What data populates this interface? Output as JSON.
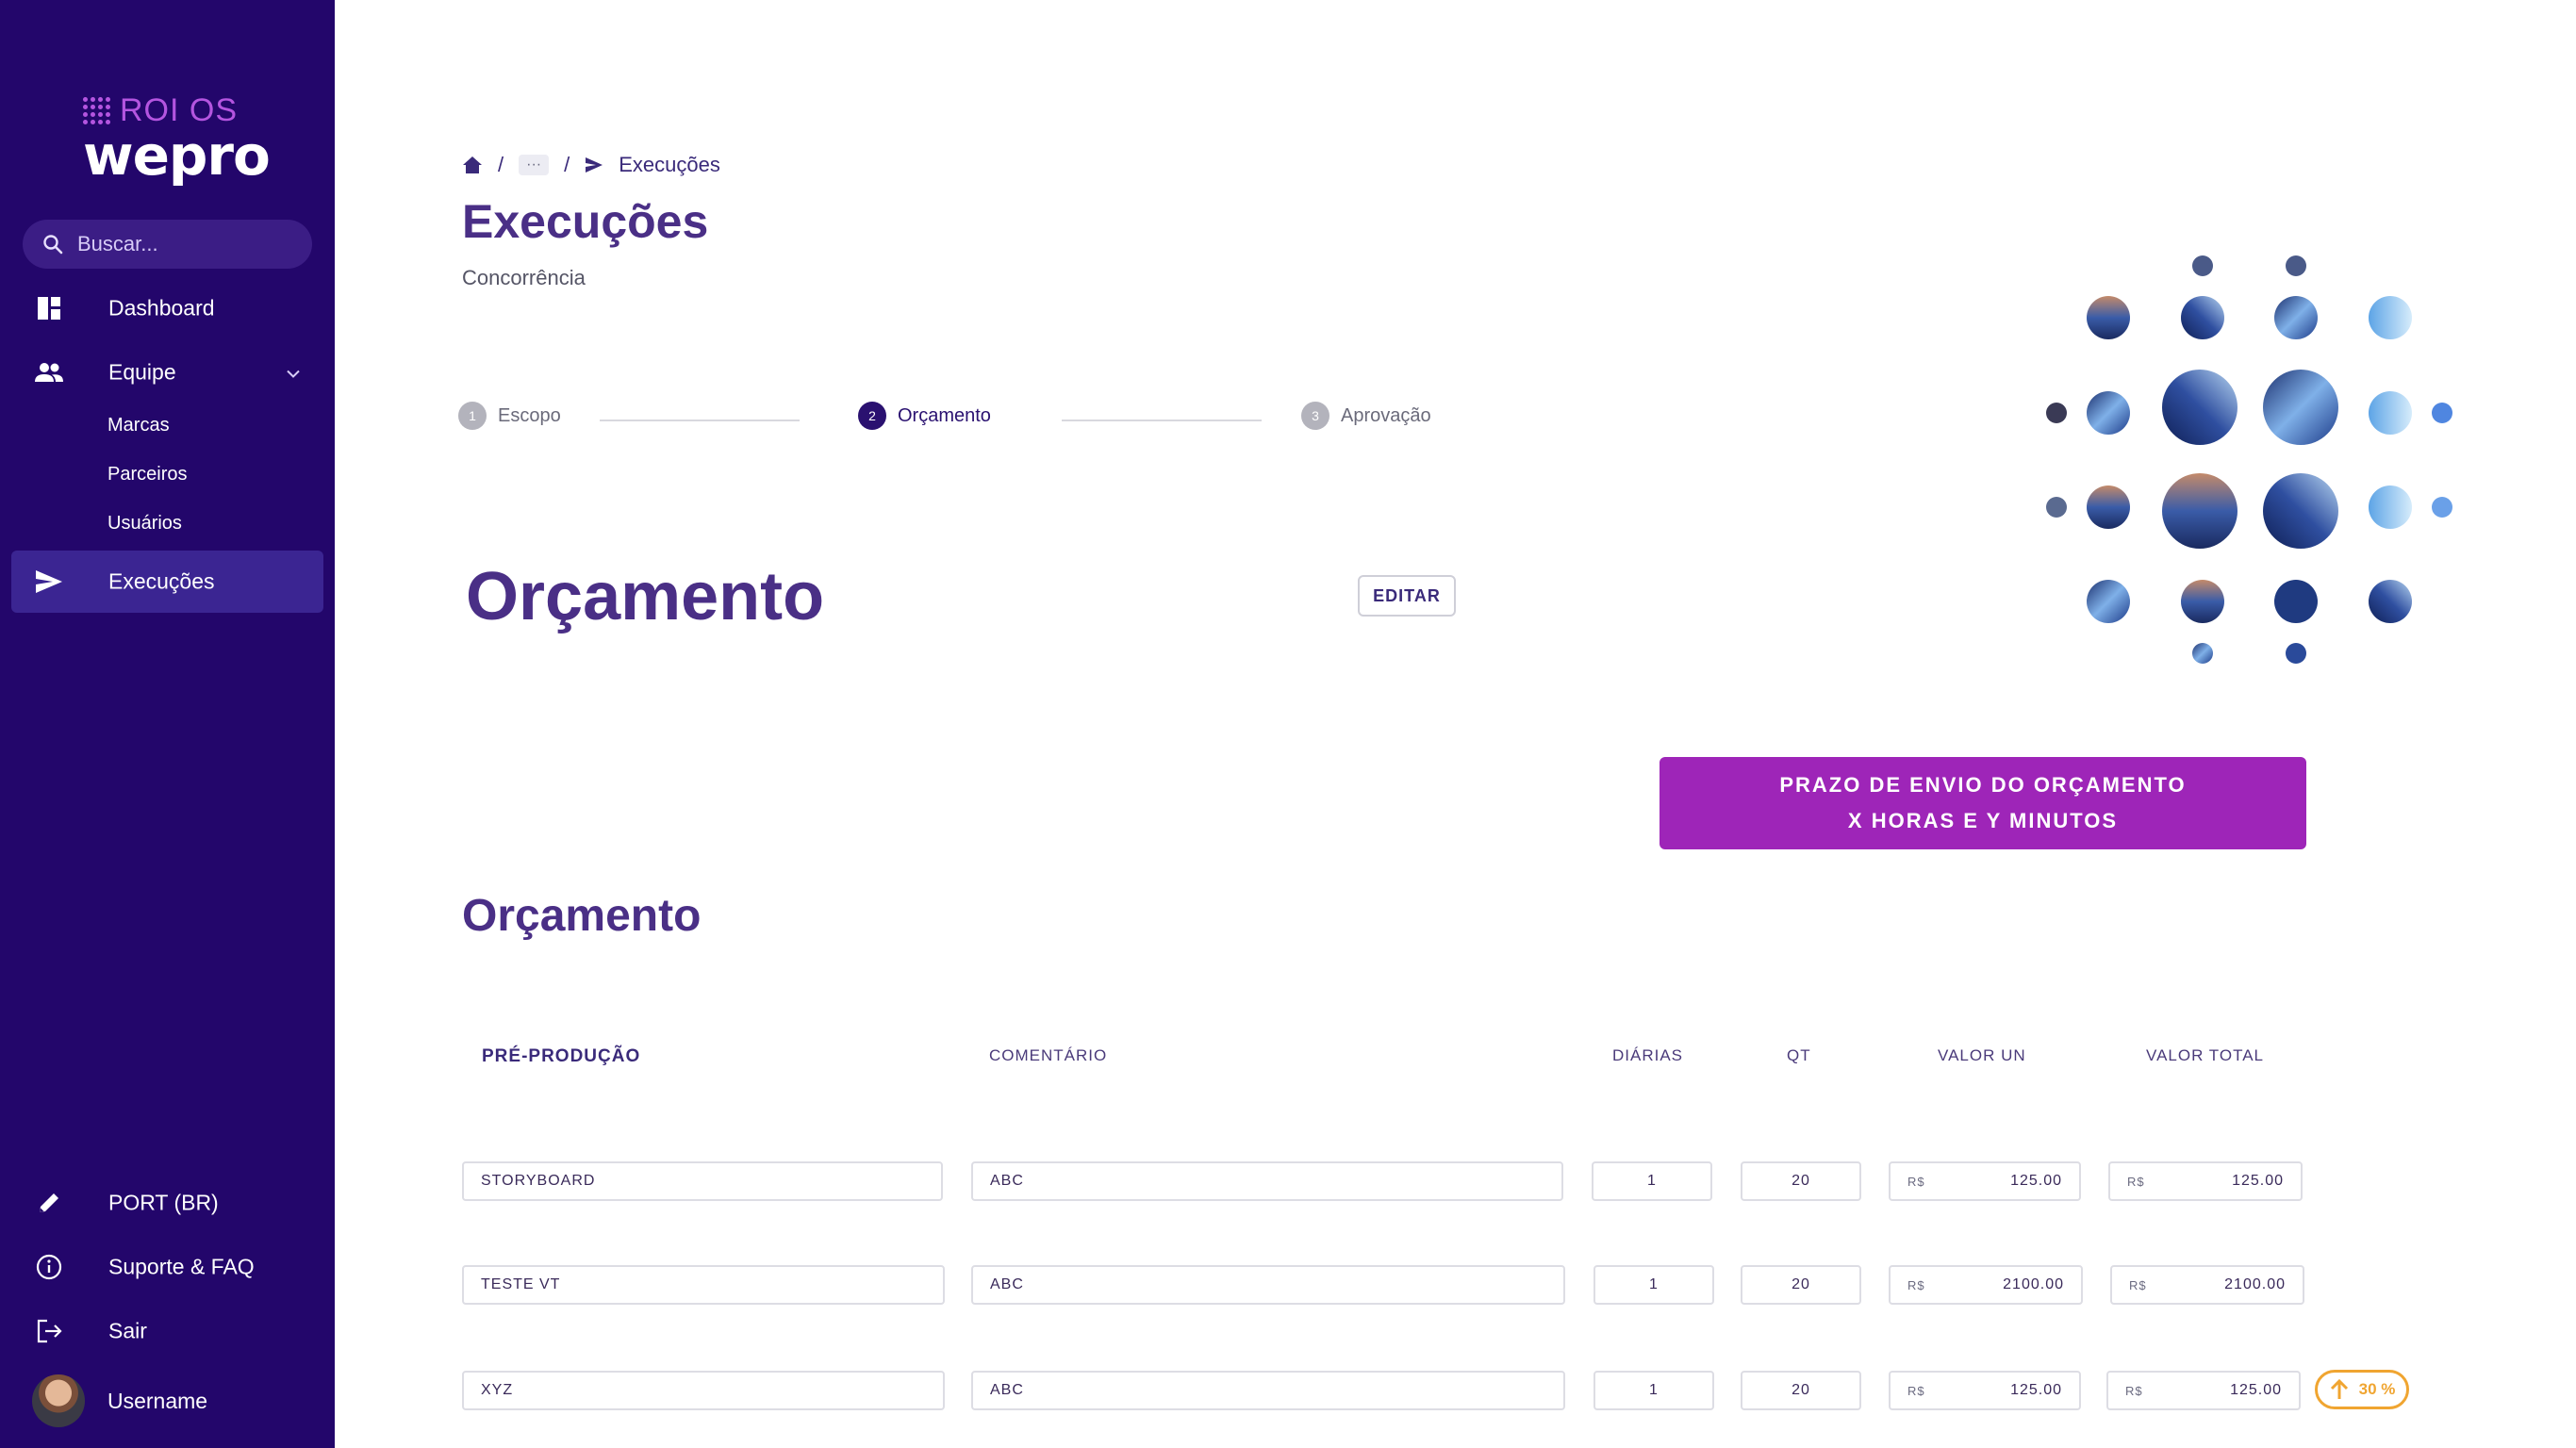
{
  "brand": {
    "small": "ROI OS",
    "big": "wepro"
  },
  "search": {
    "placeholder": "Buscar..."
  },
  "nav": {
    "dashboard": "Dashboard",
    "equipe": "Equipe",
    "sub": [
      "Marcas",
      "Parceiros",
      "Usuários"
    ],
    "execucoes": "Execuções"
  },
  "bottom_nav": {
    "language": "PORT (BR)",
    "support": "Suporte & FAQ",
    "logout": "Sair",
    "username": "Username"
  },
  "breadcrumb": {
    "current": "Execuções",
    "ellipsis": "···"
  },
  "page": {
    "title": "Execuções",
    "subtitle": "Concorrência"
  },
  "stepper": [
    {
      "num": "1",
      "label": "Escopo"
    },
    {
      "num": "2",
      "label": "Orçamento"
    },
    {
      "num": "3",
      "label": "Aprovação"
    }
  ],
  "section": {
    "title": "Orçamento",
    "edit": "EDITAR"
  },
  "deadline": {
    "line1": "PRAZO DE ENVIO DO ORÇAMENTO",
    "line2": "X HORAS E Y MINUTOS"
  },
  "budget": {
    "title": "Orçamento",
    "headers": {
      "item": "PRÉ-PRODUÇÃO",
      "comment": "COMENTÁRIO",
      "days": "DIÁRIAS",
      "qty": "QT",
      "unit": "VALOR UN",
      "total": "VALOR TOTAL"
    },
    "currency": "R$",
    "rows": [
      {
        "item": "STORYBOARD",
        "comment": "ABC",
        "days": "1",
        "qty": "20",
        "unit": "125.00",
        "total": "125.00"
      },
      {
        "item": "TESTE VT",
        "comment": "ABC",
        "days": "1",
        "qty": "20",
        "unit": "2100.00",
        "total": "2100.00"
      },
      {
        "item": "XYZ",
        "comment": "ABC",
        "days": "1",
        "qty": "20",
        "unit": "125.00",
        "total": "125.00"
      }
    ],
    "badge": "30 %"
  },
  "colors": {
    "sidebar": "#23066b",
    "accent": "#9e25b8",
    "title": "#4a2f86",
    "badge": "#f0a531"
  }
}
